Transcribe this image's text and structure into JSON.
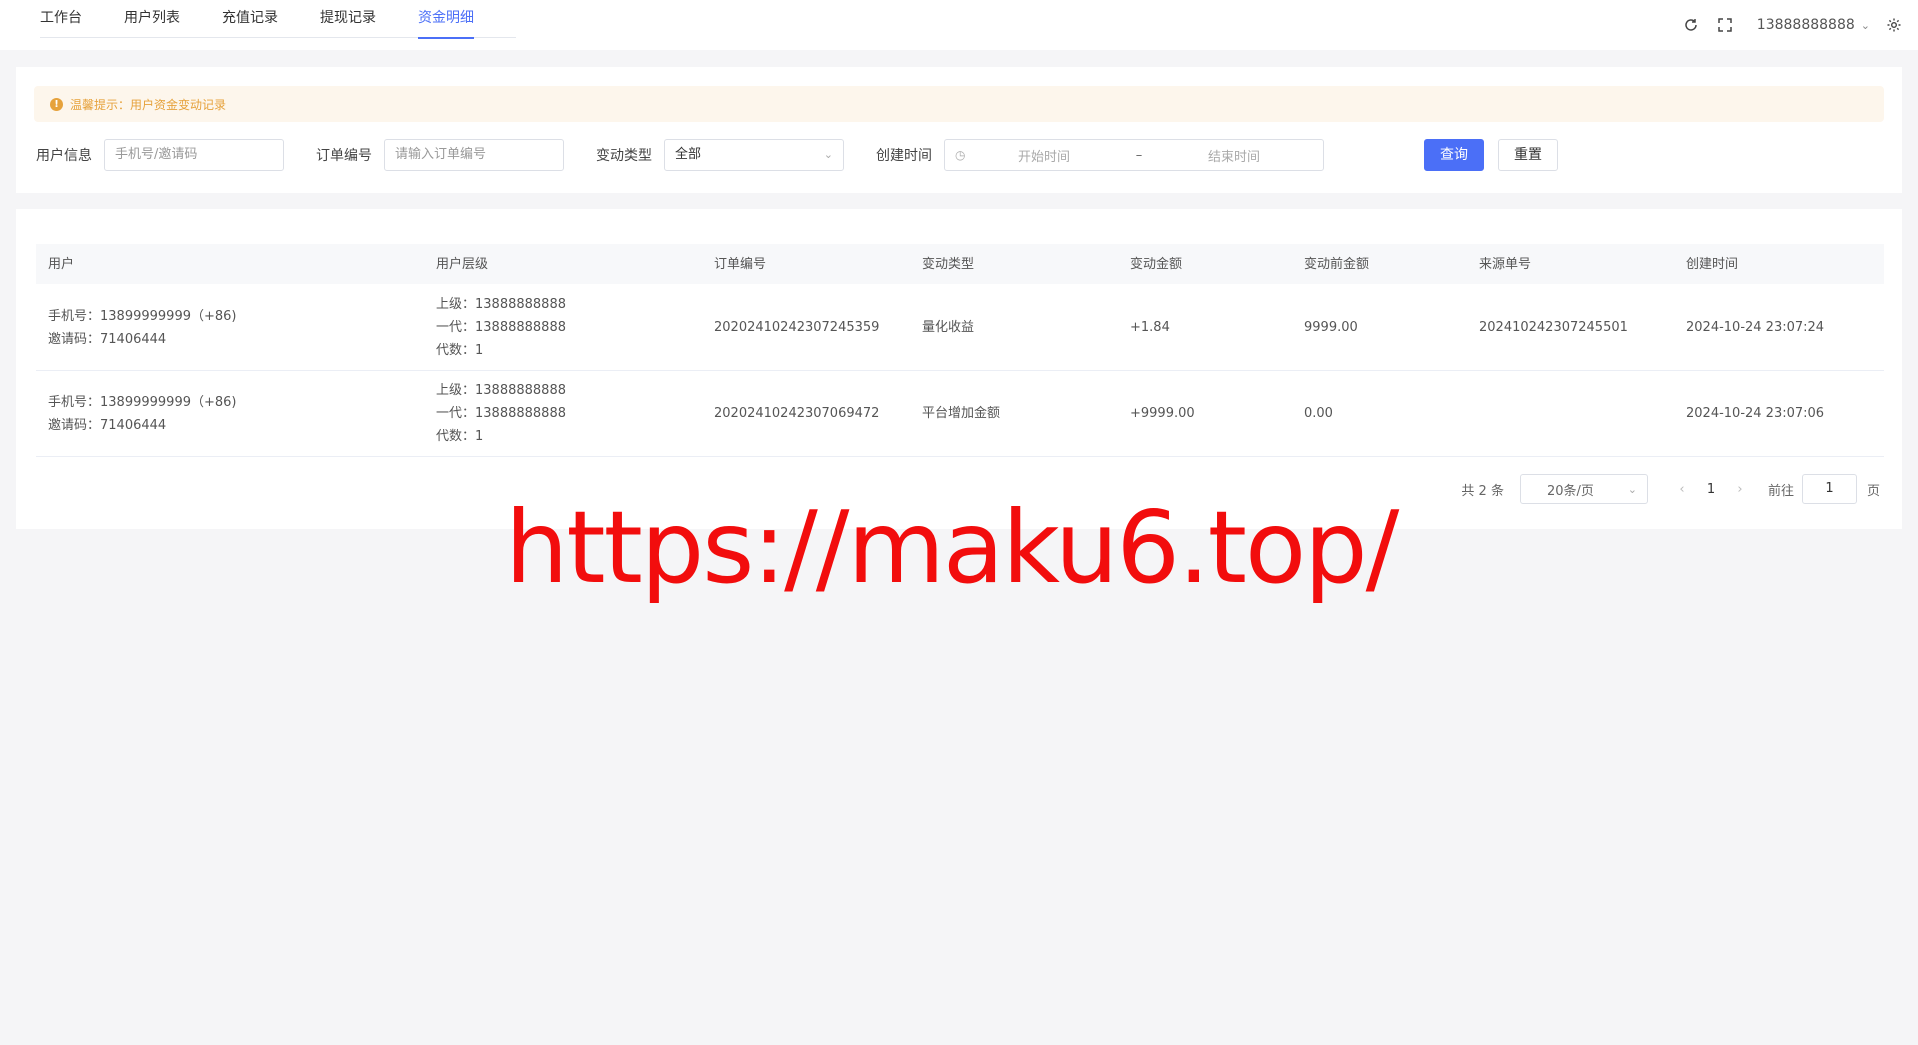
{
  "tabs": [
    {
      "label": "工作台"
    },
    {
      "label": "用户列表"
    },
    {
      "label": "充值记录"
    },
    {
      "label": "提现记录"
    },
    {
      "label": "资金明细",
      "active": true
    }
  ],
  "header": {
    "user": "13888888888",
    "icons": [
      "refresh-icon",
      "fullscreen-icon",
      "chevron-down-icon",
      "settings-icon"
    ]
  },
  "alert": {
    "text": "温馨提示：用户资金变动记录"
  },
  "filters": {
    "user_label": "用户信息",
    "user_placeholder": "手机号/邀请码",
    "order_label": "订单编号",
    "order_placeholder": "请输入订单编号",
    "type_label": "变动类型",
    "type_value": "全部",
    "time_label": "创建时间",
    "start_placeholder": "开始时间",
    "range_sep": "–",
    "end_placeholder": "结束时间",
    "query_label": "查询",
    "reset_label": "重置"
  },
  "table": {
    "columns": [
      "用户",
      "用户层级",
      "订单编号",
      "变动类型",
      "变动金额",
      "变动前金额",
      "来源单号",
      "创建时间"
    ],
    "rows": [
      {
        "phone": "手机号：13899999999（+86)",
        "invite": "邀请码：71406444",
        "superior": "上级：13888888888",
        "gen1": "一代：13888888888",
        "gens": "代数：1",
        "order_no": "20202410242307245359",
        "type": "量化收益",
        "amount": "+1.84",
        "before": "9999.00",
        "source": "202410242307245501",
        "created": "2024-10-24 23:07:24"
      },
      {
        "phone": "手机号：13899999999（+86)",
        "invite": "邀请码：71406444",
        "superior": "上级：13888888888",
        "gen1": "一代：13888888888",
        "gens": "代数：1",
        "order_no": "20202410242307069472",
        "type": "平台增加金额",
        "amount": "+9999.00",
        "before": "0.00",
        "source": "",
        "created": "2024-10-24 23:07:06"
      }
    ]
  },
  "pagination": {
    "total": "共 2 条",
    "page_size": "20条/页",
    "prev": "‹",
    "current": "1",
    "next": "›",
    "goto_label": "前往",
    "goto_value": "1",
    "page_suffix": "页"
  },
  "watermark": "https://maku6.top/",
  "colors": {
    "accent": "#4b6ff7",
    "alert_bg": "#fdf6ec",
    "alert_text": "#e6a23c",
    "watermark": "#f20d0d"
  }
}
